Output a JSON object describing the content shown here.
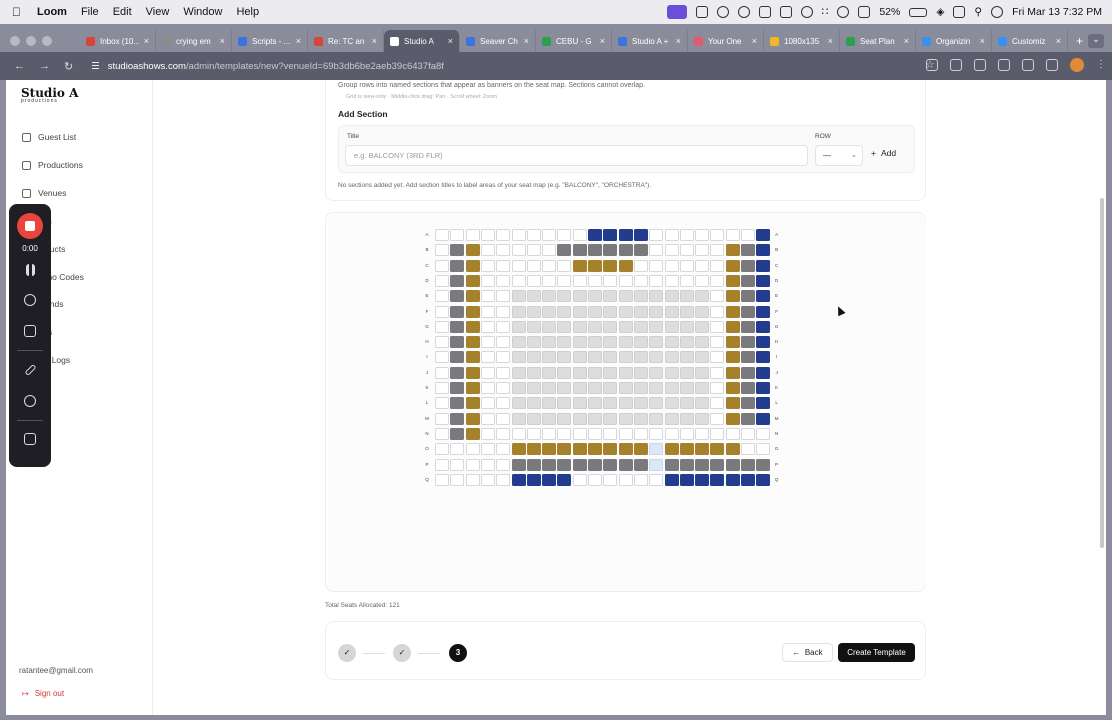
{
  "menubar": {
    "app_name": "Loom",
    "menus": [
      "File",
      "Edit",
      "View",
      "Window",
      "Help"
    ],
    "battery": "52%",
    "datetime": "Fri Mar 13  7:32 PM"
  },
  "browser": {
    "tabs": [
      {
        "title": "Inbox (10...",
        "color": "#d9453a"
      },
      {
        "title": "crying em",
        "color": "#8b8b8b"
      },
      {
        "title": "Scripts - ...",
        "color": "#3a74e0"
      },
      {
        "title": "Re: TC an",
        "color": "#d9453a"
      },
      {
        "title": "Studio A",
        "color": "#ffffff"
      },
      {
        "title": "Seaver Ch",
        "color": "#3a74e0"
      },
      {
        "title": "CEBU - G",
        "color": "#2e9e4f"
      },
      {
        "title": "Studio A +",
        "color": "#3a74e0"
      },
      {
        "title": "Your One",
        "color": "#e55a6a"
      },
      {
        "title": "1080x135",
        "color": "#f2b824"
      },
      {
        "title": "Seat Plan",
        "color": "#2e9e4f"
      },
      {
        "title": "Organizin",
        "color": "#3a8ff0"
      },
      {
        "title": "Customiz",
        "color": "#3a8ff0"
      }
    ],
    "active_tab": 4,
    "url_host": "studioashows.com",
    "url_path": "/admin/templates/new?venueId=69b3db6be2aeb39c6437fa8f"
  },
  "sidebar": {
    "logo_text": "Studio A",
    "logo_sub": "productions",
    "items": [
      {
        "label": "Guest List",
        "icon": "users-icon"
      },
      {
        "label": "Productions",
        "icon": "film-icon"
      },
      {
        "label": "Venues",
        "icon": "pin-icon"
      },
      {
        "label": "...ts",
        "icon": "ticket-icon"
      },
      {
        "label": "...ducts",
        "icon": "box-icon"
      },
      {
        "label": "...mo Codes",
        "icon": "tag-icon"
      },
      {
        "label": "...unds",
        "icon": "refund-icon"
      },
      {
        "label": "...rs",
        "icon": "user-icon"
      },
      {
        "label": "...it Logs",
        "icon": "log-icon"
      }
    ],
    "user_email": "ratantee@gmail.com",
    "signout_label": "Sign out"
  },
  "loom": {
    "timer": "0:00"
  },
  "sections": {
    "description": "Group rows into named sections that appear as banners on the seat map. Sections cannot overlap.",
    "hint": "Grid is view-only · Middle-click drag: Pan · Scroll wheel: Zoom",
    "add_heading": "Add Section",
    "title_label": "Title",
    "title_placeholder": "e.g. BALCONY (3RD FLR)",
    "row_label": "ROW",
    "row_value": "—",
    "add_button": "Add",
    "empty_message": "No sections added yet. Add section titles to label areas of your seat map (e.g. \"BALCONY\", \"ORCHESTRA\")."
  },
  "seat_map": {
    "rows": [
      "A",
      "B",
      "C",
      "D",
      "E",
      "F",
      "G",
      "H",
      "I",
      "J",
      "K",
      "L",
      "M",
      "N",
      "O",
      "P",
      "Q"
    ],
    "columns": 22
  },
  "total_seats": "Total Seats Allocated: 121",
  "stepper": {
    "steps": [
      "✓",
      "✓",
      "3"
    ],
    "current": 3
  },
  "actions": {
    "back": "Back",
    "create": "Create Template"
  }
}
